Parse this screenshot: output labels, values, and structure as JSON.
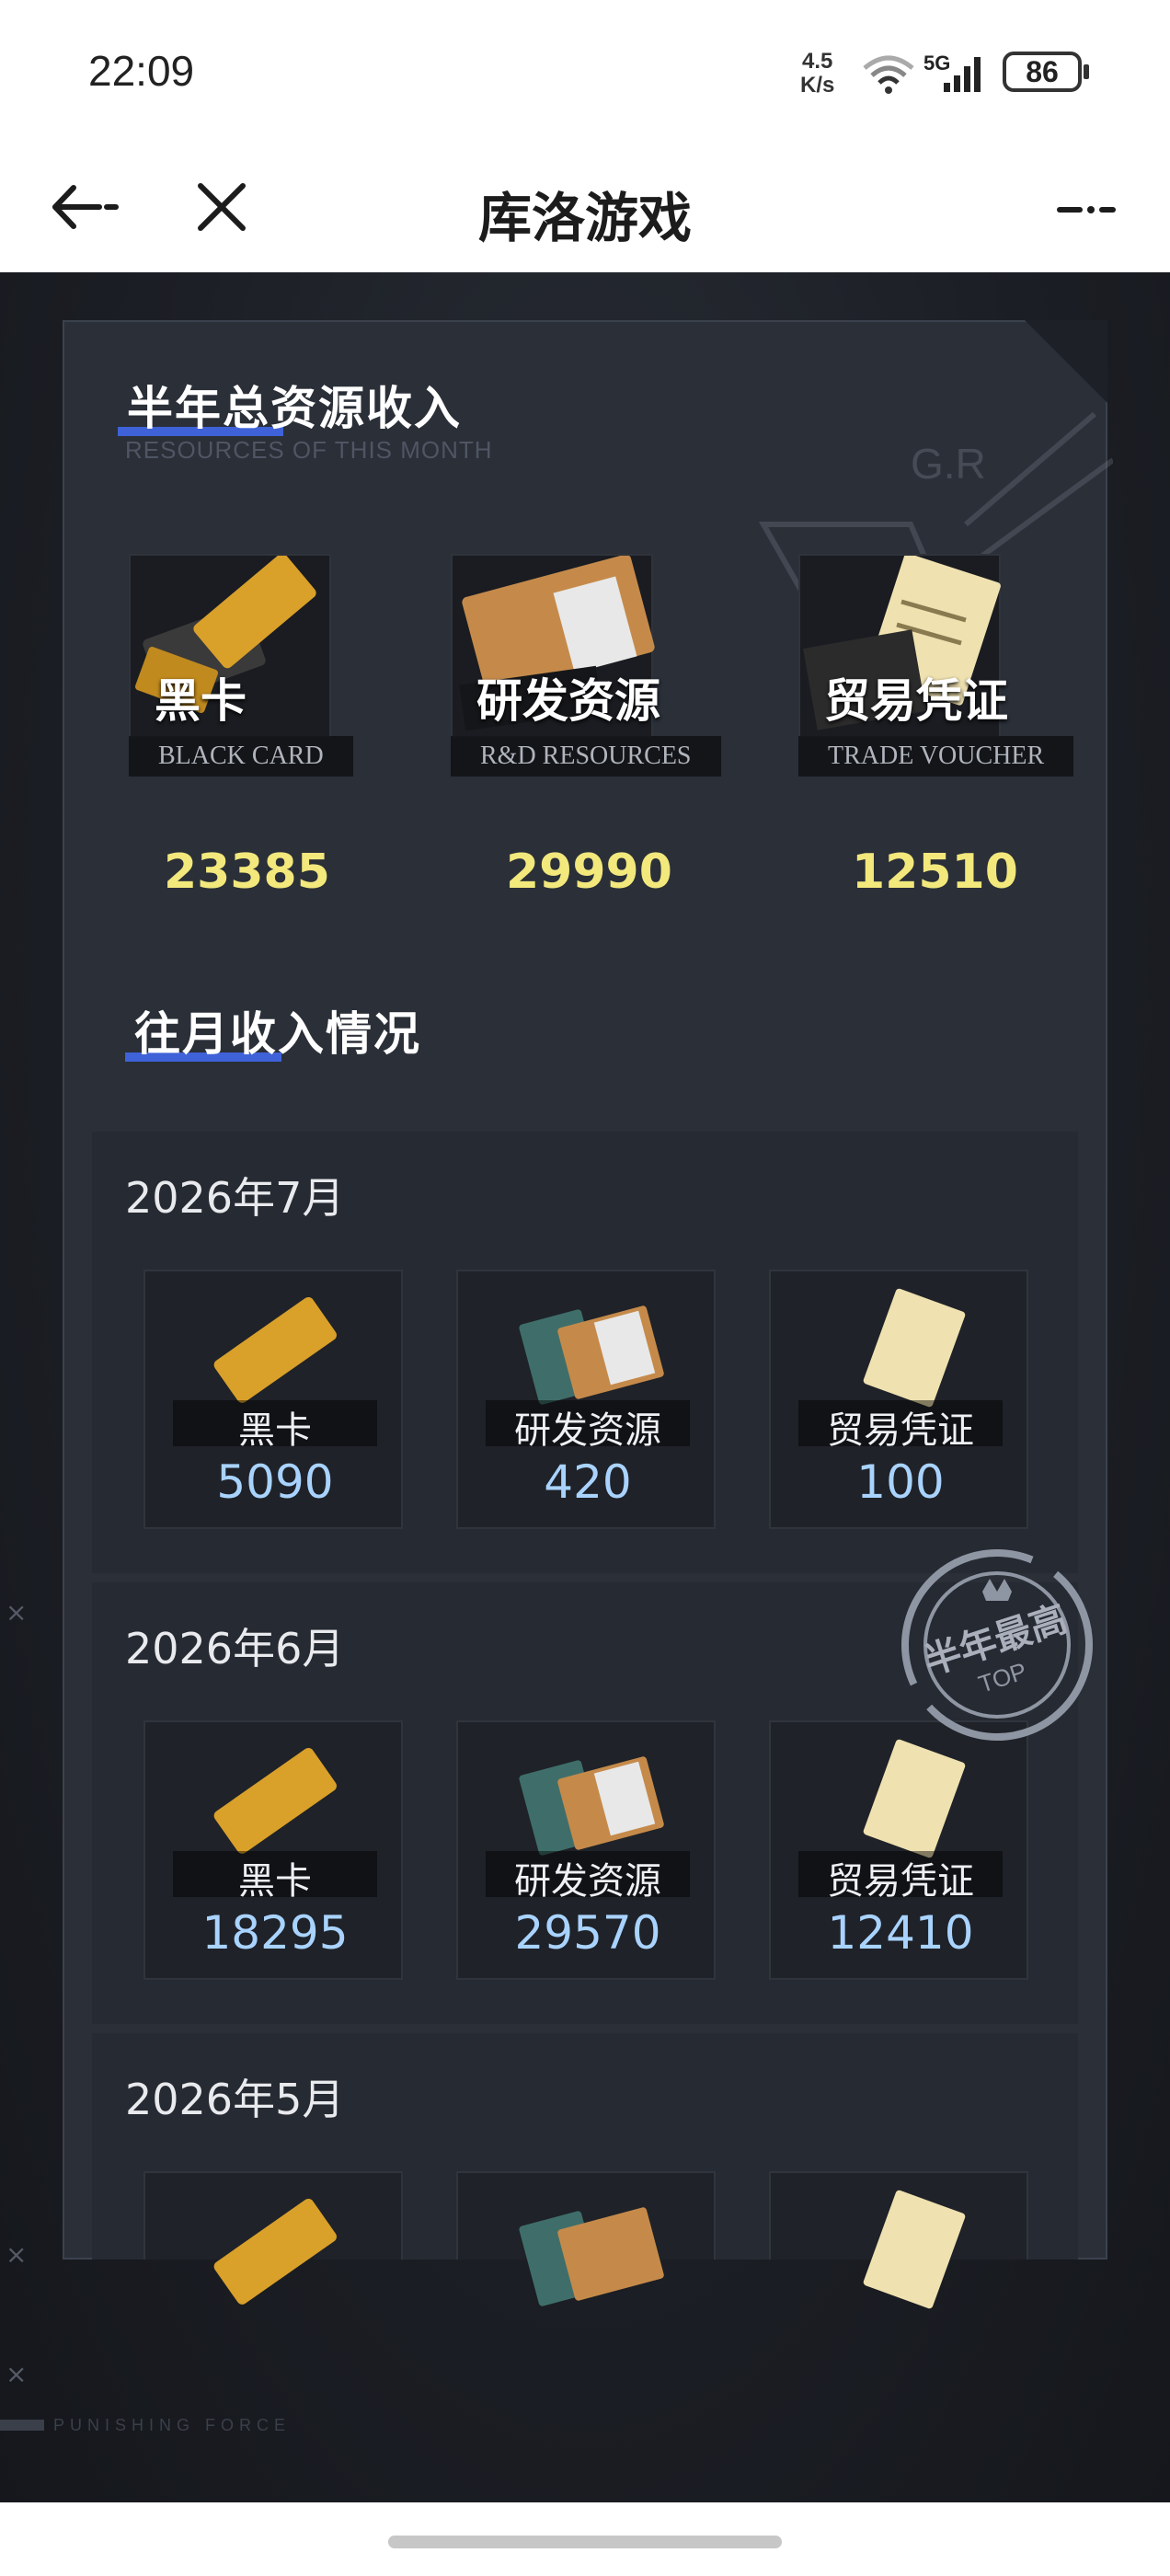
{
  "status_bar": {
    "time": "22:09",
    "net_speed_value": "4.5",
    "net_speed_unit": "K/s",
    "network_type": "5G",
    "battery": "86"
  },
  "nav": {
    "title": "库洛游戏"
  },
  "summary": {
    "title": "半年总资源收入",
    "subtitle": "RESOURCES OF THIS MONTH",
    "items": [
      {
        "label": "黑卡",
        "en": "BLACK CARD",
        "value": "23385"
      },
      {
        "label": "研发资源",
        "en": "R&D RESOURCES",
        "value": "29990"
      },
      {
        "label": "贸易凭证",
        "en": "TRADE VOUCHER",
        "value": "12510"
      }
    ]
  },
  "history": {
    "title": "往月收入情况",
    "months": [
      {
        "month": "2026年7月",
        "items": [
          {
            "label": "黑卡",
            "value": "5090"
          },
          {
            "label": "研发资源",
            "value": "420"
          },
          {
            "label": "贸易凭证",
            "value": "100"
          }
        ]
      },
      {
        "month": "2026年6月",
        "items": [
          {
            "label": "黑卡",
            "value": "18295"
          },
          {
            "label": "研发资源",
            "value": "29570"
          },
          {
            "label": "贸易凭证",
            "value": "12410"
          }
        ]
      },
      {
        "month": "2026年5月",
        "items": []
      }
    ]
  },
  "badge": {
    "text": "半年最高",
    "sub": "TOP"
  },
  "decor": {
    "bottom_text": "PUNISHING FORCE",
    "panel_mark": "G.R"
  },
  "colors": {
    "accent_blue": "#3f62d8",
    "value_yellow": "#f2e87c",
    "value_blue": "#a9d3ff",
    "gold": "#d9a02a"
  }
}
